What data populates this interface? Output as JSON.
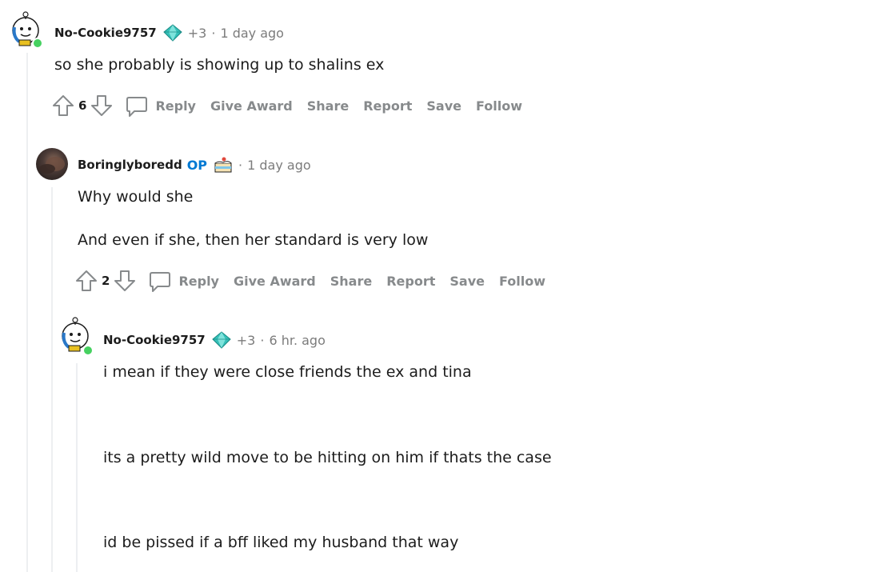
{
  "comments": [
    {
      "username": "No-Cookie9757",
      "plus": "+3",
      "sep": "·",
      "time": "1 day ago",
      "lines": [
        "so she probably is showing up to shalins ex"
      ],
      "score": "6"
    },
    {
      "username": "Boringlyboredd",
      "op": "OP",
      "sep": "·",
      "time": "1 day ago",
      "lines": [
        "Why would she",
        "And even if she, then her standard is very low"
      ],
      "score": "2"
    },
    {
      "username": "No-Cookie9757",
      "plus": "+3",
      "sep": "·",
      "time": "6 hr. ago",
      "lines": [
        "i mean if they were close friends the ex and tina",
        "its a pretty wild move to be hitting on him if thats the case",
        "id be pissed if a bff liked my husband that way"
      ]
    }
  ],
  "actions": {
    "reply": "Reply",
    "give_award": "Give Award",
    "share": "Share",
    "report": "Report",
    "save": "Save",
    "follow": "Follow"
  },
  "icons": {
    "upvote": "upvote-arrow-icon",
    "downvote": "downvote-arrow-icon",
    "comment": "speech-bubble-icon",
    "flair_diamond": "diamond-icon",
    "flair_cake": "cake-icon"
  },
  "colors": {
    "op": "#0079d3",
    "muted": "#7c7c7c",
    "action": "#878a8c",
    "online": "#46d160",
    "thread": "#edeff1"
  }
}
